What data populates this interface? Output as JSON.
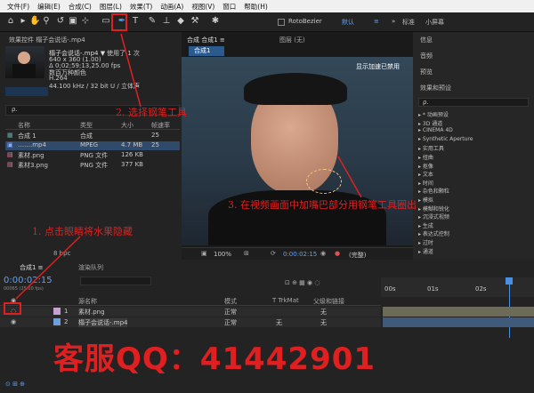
{
  "menu": [
    "文件(F)",
    "编辑(E)",
    "合成(C)",
    "图层(L)",
    "效果(T)",
    "动画(A)",
    "视图(V)",
    "窗口",
    "帮助(H)"
  ],
  "toolbar": {
    "rotobezier": "RotoBezier",
    "default": "默认",
    "right_labels": [
      "»",
      "标准",
      "小屏幕"
    ]
  },
  "project": {
    "title": "效果控件 榻子会说话-.mp4",
    "footage_name": "榻子会说话-.mp4 ▼",
    "footage_used": "使用了 1 次",
    "footage_dims": "640 x 360 (1.00)",
    "footage_dur": "Δ 0;02;59;13,25.00 fps",
    "footage_colors": "数百万种颜色",
    "footage_codec": "H.264",
    "footage_audio": "44.100 kHz / 32 bit U / 立体声",
    "search_placeholder": "ρ.",
    "columns": [
      "名称",
      "类型",
      "大小",
      "帧速率"
    ],
    "items": [
      {
        "name": "合成 1",
        "type": "合成",
        "size": "",
        "fps": "25"
      },
      {
        "name": "…….mp4",
        "type": "MPEG",
        "size": "4.7 MB",
        "fps": "25"
      },
      {
        "name": "素材.png",
        "type": "PNG 文件",
        "size": "126 KB",
        "fps": ""
      },
      {
        "name": "素材3.png",
        "type": "PNG 文件",
        "size": "377 KB",
        "fps": ""
      }
    ],
    "bpc": "8 bpc"
  },
  "composition": {
    "tab_label": "合成 合成1 ≡",
    "layer_tab": "图层 (无)",
    "inner_tab": "合成1",
    "overlay_text": "显示加速已禁用",
    "zoom": "100%",
    "timecode": "0:00:02:15",
    "view": "(完整)"
  },
  "right_panel": {
    "tabs": [
      "信息",
      "音频",
      "预览",
      "效果和预设"
    ],
    "search": "ρ.",
    "effects": [
      "▸ * 动画预设",
      "▸ 3D 通道",
      "▸ CINEMA 4D",
      "▸ Synthetic Aperture",
      "▸ 实用工具",
      "▸ 扭曲",
      "▸ 抠像",
      "▸ 文本",
      "▸ 时间",
      "▸ 杂色和颗粒",
      "▸ 模拟",
      "▸ 模糊和锐化",
      "▸ 沉浸式视频",
      "▸ 生成",
      "▸ 表达式控制",
      "▸ 过时",
      "▸ 通道"
    ]
  },
  "timeline": {
    "tab": "合成1 ≡",
    "tab2": "渲染队列",
    "timecode": "0:00:02:15",
    "timecode_sub": "00065 (25.00 fps)",
    "columns": [
      "源名称",
      "模式",
      "T TrkMat",
      "父级和链接"
    ],
    "layers": [
      {
        "num": "1",
        "name": "素材.png",
        "mode": "正常",
        "trk": "",
        "parent": "无"
      },
      {
        "num": "2",
        "name": "榻子会说话-.mp4",
        "mode": "正常",
        "trk": "无",
        "parent": "无"
      }
    ],
    "ruler": [
      "00s",
      "01s",
      "02s"
    ]
  },
  "annotations": {
    "step1": "1. 点击眼睛将水果隐藏",
    "step2": "2. 选择钢笔工具",
    "step3": "3. 在视频画面中加嘴巴部分用钢笔工具圈出",
    "qq": "客服QQ：41442901"
  }
}
